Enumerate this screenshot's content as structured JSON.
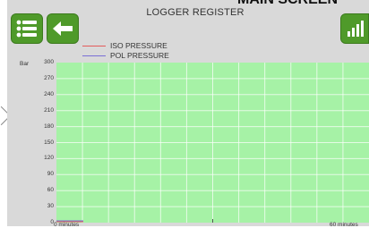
{
  "header": {
    "title": "LOGGER REGISTER",
    "top_clipped_text": "MAIN SCREEN",
    "menu_icon": "list-icon",
    "back_icon": "arrow-left-icon",
    "signal_icon": "signal-bars-icon"
  },
  "colors": {
    "button_green": "#4f9a2a",
    "plot_background": "#a6f2a6",
    "iso_line": "#e35b5b",
    "pol_line": "#7a6fd6"
  },
  "chart_data": {
    "type": "line",
    "title": "LOGGER REGISTER",
    "ylabel": "Bar",
    "ylim": [
      0,
      300
    ],
    "yticks": [
      "300",
      "270",
      "240",
      "210",
      "180",
      "150",
      "120",
      "90",
      "60",
      "30",
      "0"
    ],
    "xticks": [
      "0 minutes",
      "60 minutes"
    ],
    "grid": true,
    "legend_placement": "top-left",
    "series": [
      {
        "name": "ISO PRESSURE",
        "color": "#e35b5b",
        "values": []
      },
      {
        "name": "POL PRESSURE",
        "color": "#7a6fd6",
        "values": []
      }
    ]
  }
}
